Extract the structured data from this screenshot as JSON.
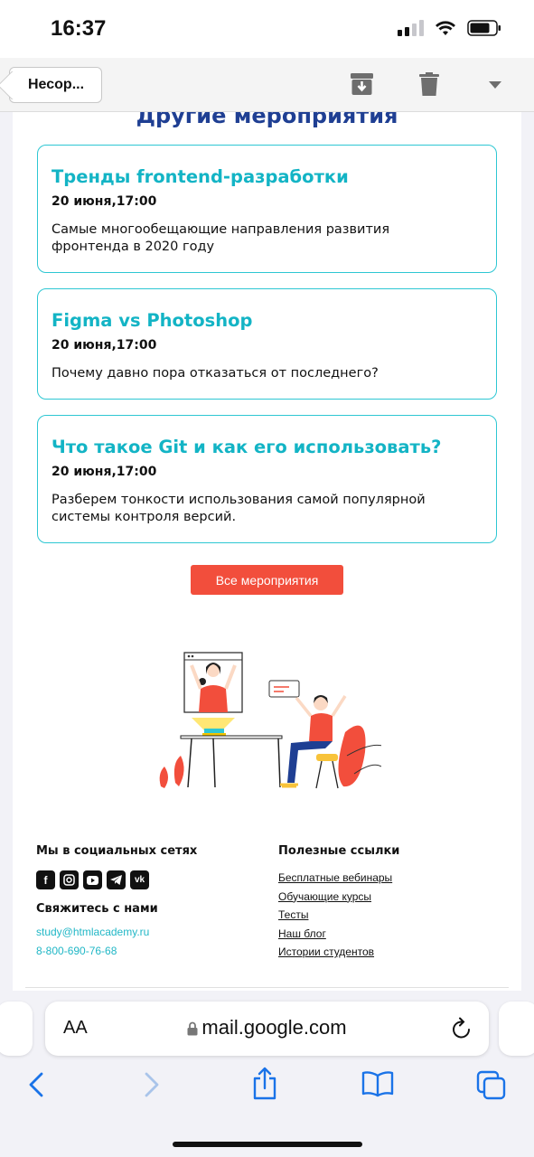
{
  "status_bar": {
    "time": "16:37"
  },
  "mail_toolbar": {
    "back_label": "Несор..."
  },
  "email": {
    "section_title": "Другие мероприятия",
    "events": [
      {
        "title": "Тренды frontend-разработки",
        "date": "20 июня,17:00",
        "description": "Самые многообещающие направления развития фронтенда в 2020 году"
      },
      {
        "title": "Figma vs Photoshop",
        "date": "20 июня,17:00",
        "description": "Почему давно пора отказаться от последнего?"
      },
      {
        "title": "Что такое Git и как его использовать?",
        "date": "20 июня,17:00",
        "description": "Разберем тонкости использования самой популярной системы контроля версий."
      }
    ],
    "all_events_button": "Все мероприятия",
    "footer": {
      "social_heading": "Мы в социальных сетях",
      "social_icons": [
        "facebook-icon",
        "instagram-icon",
        "youtube-icon",
        "telegram-icon",
        "vk-icon"
      ],
      "contact_heading": "Свяжитесь с нами",
      "email": "study@htmlacademy.ru",
      "phone": "8-800-690-76-68",
      "links_heading": "Полезные ссылки",
      "links": [
        "Бесплатные вебинары",
        "Обучающие курсы",
        "Тесты",
        "Наш блог",
        "Истории студентов"
      ]
    }
  },
  "safari": {
    "aa_label": "AA",
    "url": "mail.google.com"
  },
  "colors": {
    "accent_cyan": "#13b4c5",
    "title_blue": "#1f3f93",
    "button_red": "#f24e3c"
  }
}
